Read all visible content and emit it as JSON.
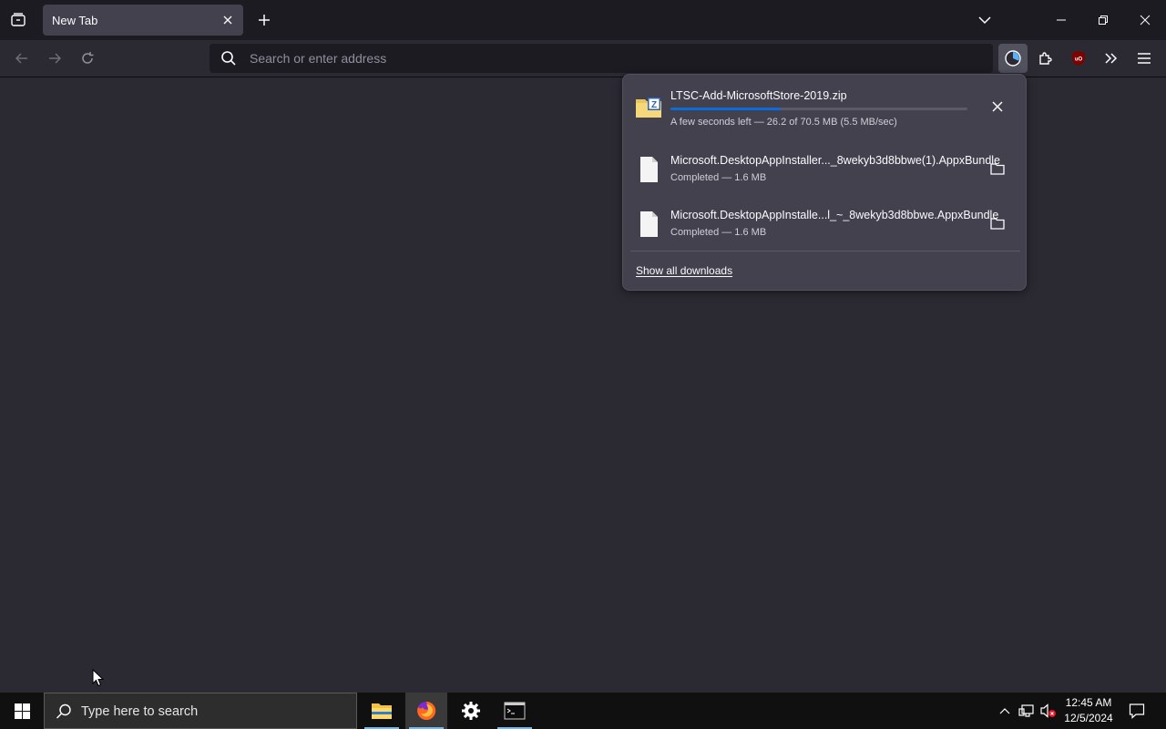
{
  "tabs": [
    {
      "title": "New Tab",
      "active": true
    }
  ],
  "urlbar": {
    "placeholder": "Search or enter address",
    "value": ""
  },
  "downloads": {
    "items": [
      {
        "name": "LTSC-Add-MicrosoftStore-2019.zip",
        "status": "A few seconds left — 26.2 of 70.5 MB (5.5 MB/sec)",
        "progress": 0.37,
        "state": "in-progress",
        "icon": "zip-folder-icon",
        "action": "cancel-icon"
      },
      {
        "name": "Microsoft.DesktopAppInstaller..._8wekyb3d8bbwe(1).AppxBundle",
        "status": "Completed — 1.6 MB",
        "state": "completed",
        "icon": "file-icon",
        "action": "folder-icon"
      },
      {
        "name": "Microsoft.DesktopAppInstalle...l_~_8wekyb3d8bbwe.AppxBundle",
        "status": "Completed — 1.6 MB",
        "state": "completed",
        "icon": "file-icon",
        "action": "folder-icon"
      }
    ],
    "show_all_label": "Show all downloads"
  },
  "taskbar": {
    "search_placeholder": "Type here to search",
    "apps": [
      "file-explorer-icon",
      "firefox-icon",
      "settings-icon",
      "terminal-icon"
    ],
    "clock_time": "12:45 AM",
    "clock_date": "12/5/2024"
  },
  "colors": {
    "tab_strip": "#1c1b22",
    "toolbar": "#2b2a33",
    "panel": "#42414d",
    "progress": "#0b6cdb",
    "taskbar": "#101010"
  }
}
